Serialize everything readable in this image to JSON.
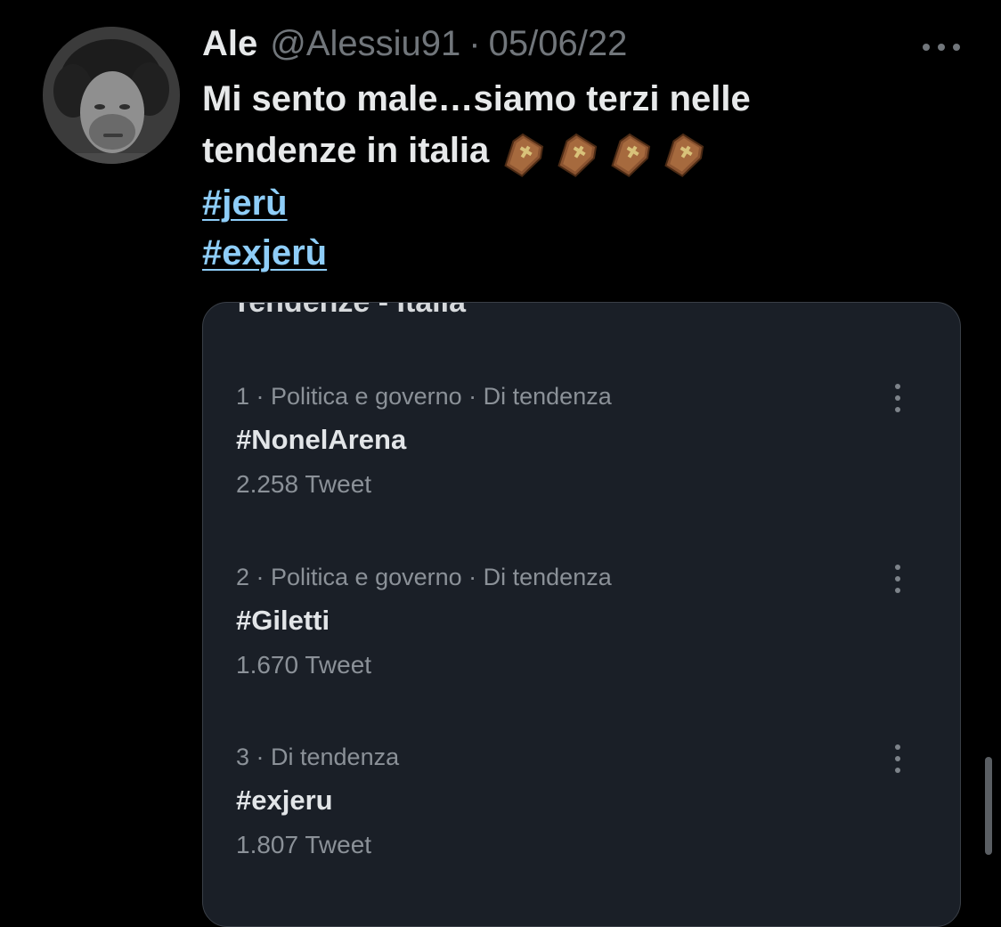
{
  "tweet": {
    "author_name": "Ale",
    "author_handle": "@Alessiu91",
    "separator": "·",
    "date": "05/06/22",
    "more_icon": "more-horizontal-icon",
    "text_line1": "Mi sento male…siamo terzi nelle",
    "text_line2": "tendenze in italia",
    "emoji": "coffin-emoji",
    "emoji_count": 4,
    "hashtags": [
      "#jerù",
      "#exjerù"
    ],
    "link_color": "#8ecdf8"
  },
  "media": {
    "title": "Tendenze - Italia",
    "trends": [
      {
        "meta": "1 · Politica e governo · Di tendenza",
        "name": "#NonelArena",
        "count": "2.258 Tweet"
      },
      {
        "meta": "2 · Politica e governo · Di tendenza",
        "name": "#Giletti",
        "count": "1.670 Tweet"
      },
      {
        "meta": "3 · Di tendenza",
        "name": "#exjeru",
        "count": "1.807 Tweet"
      }
    ],
    "card_background": "#1a1f27"
  }
}
